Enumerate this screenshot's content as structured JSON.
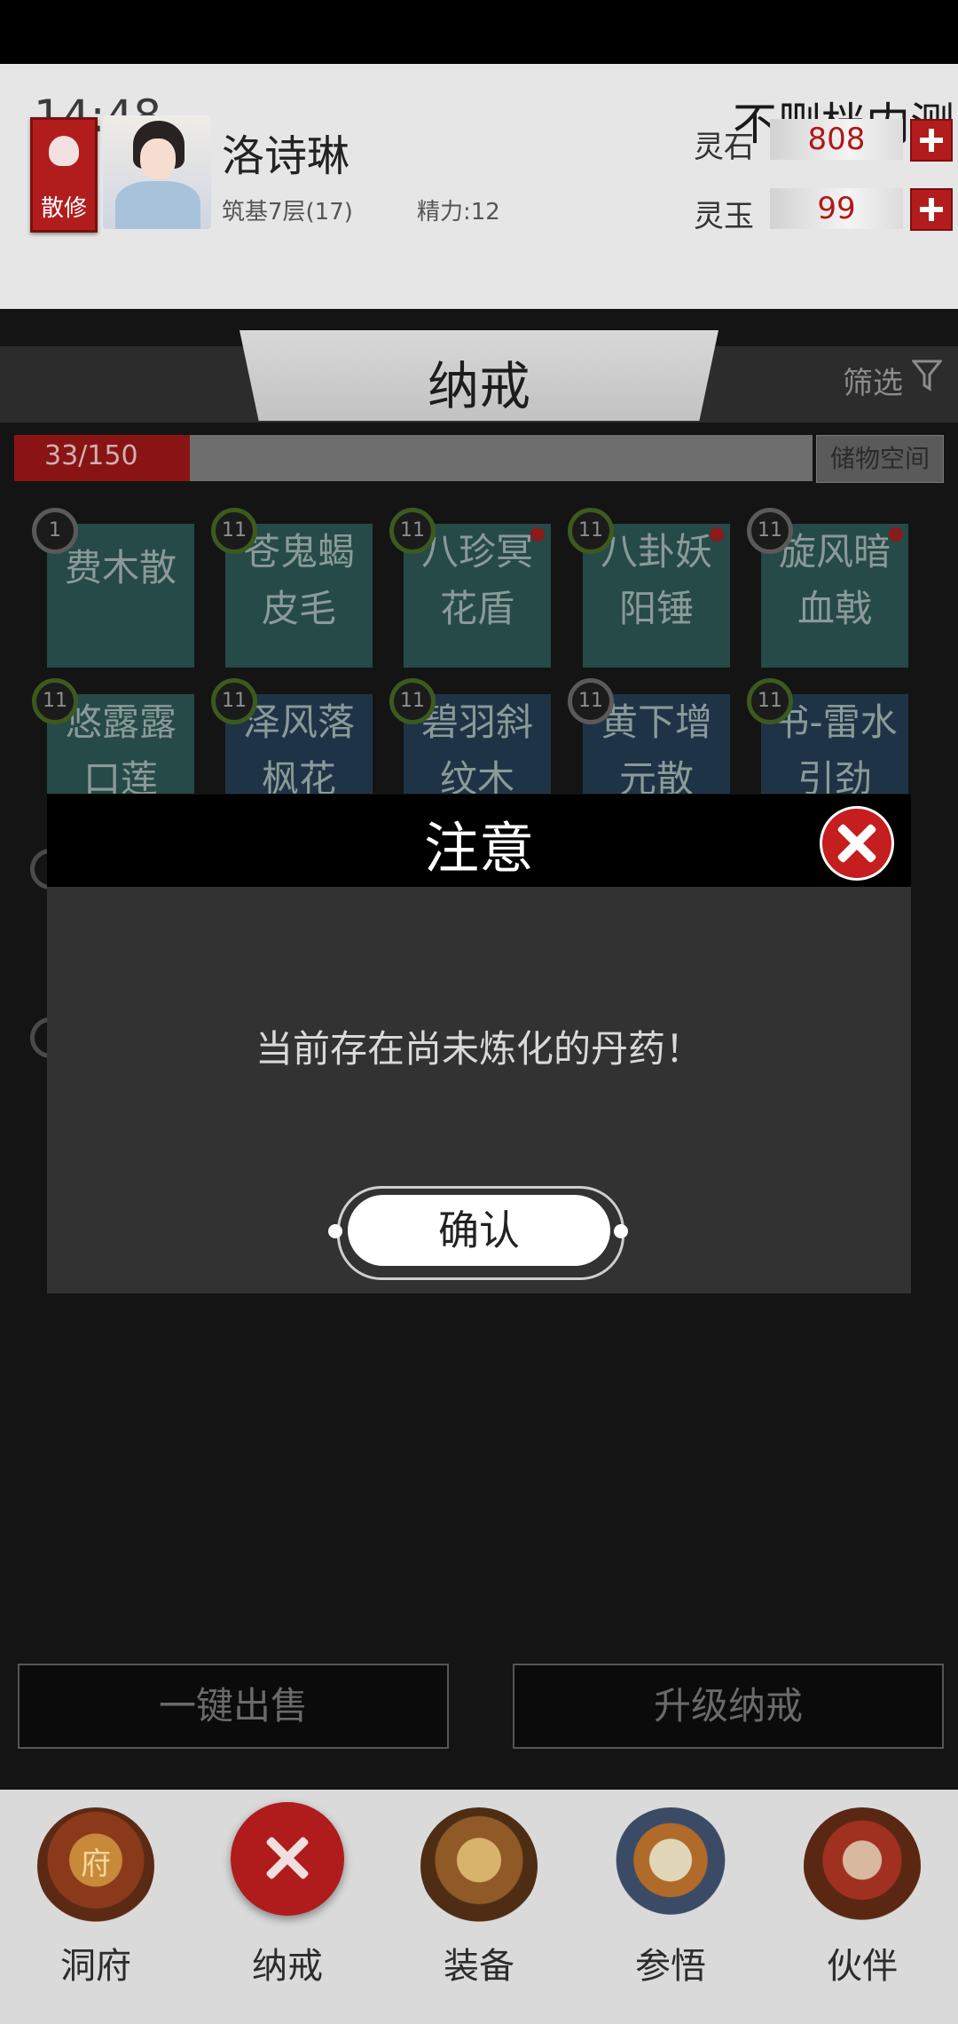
{
  "status": {
    "time": "14:48",
    "server": "不删档内测"
  },
  "player": {
    "sect": "散修",
    "name": "洛诗琳",
    "realm": "筑基7层(17)",
    "stamina": "精力:12"
  },
  "currency": {
    "spirit_stone_label": "灵石",
    "spirit_stone_value": "808",
    "spirit_jade_label": "灵玉",
    "spirit_jade_value": "99"
  },
  "page": {
    "title": "纳戒",
    "filter": "筛选"
  },
  "capacity": {
    "text": "33/150",
    "used": 33,
    "total": 150,
    "storage_button": "储物空间"
  },
  "items_row1": [
    {
      "name_l1": "费木散",
      "name_l2": "",
      "level": "1",
      "ring": "gray",
      "dot": false
    },
    {
      "name_l1": "苍鬼蝎",
      "name_l2": "皮毛",
      "level": "11",
      "ring": "green",
      "dot": false
    },
    {
      "name_l1": "八珍冥",
      "name_l2": "花盾",
      "level": "11",
      "ring": "green",
      "dot": true
    },
    {
      "name_l1": "八卦妖",
      "name_l2": "阳锤",
      "level": "11",
      "ring": "green",
      "dot": true
    },
    {
      "name_l1": "旋风暗",
      "name_l2": "血戟",
      "level": "11",
      "ring": "gray",
      "dot": true
    }
  ],
  "items_row2": [
    {
      "name_l1": "悠露露",
      "name_l2": "口莲",
      "level": "11",
      "ring": "green"
    },
    {
      "name_l1": "泽风落",
      "name_l2": "枫花",
      "level": "11",
      "ring": "green"
    },
    {
      "name_l1": "碧羽斜",
      "name_l2": "纹木",
      "level": "11",
      "ring": "green"
    },
    {
      "name_l1": "黄下增",
      "name_l2": "元散",
      "level": "11",
      "ring": "gray"
    },
    {
      "name_l1": "书-雷水",
      "name_l2": "引劲",
      "level": "11",
      "ring": "green"
    }
  ],
  "dialog": {
    "title": "注意",
    "message": "当前存在尚未炼化的丹药！",
    "confirm": "确认"
  },
  "actions": {
    "sell_all": "一键出售",
    "upgrade": "升级纳戒"
  },
  "nav": [
    {
      "label": "洞府",
      "icon": "mansion-emblem-icon",
      "badge_text": "府"
    },
    {
      "label": "纳戒",
      "icon": "close-icon"
    },
    {
      "label": "装备",
      "icon": "helmet-emblem-icon"
    },
    {
      "label": "参悟",
      "icon": "scroll-emblem-icon"
    },
    {
      "label": "伙伴",
      "icon": "companion-emblem-icon"
    }
  ],
  "colors": {
    "accent_red": "#b21c1c",
    "value_red": "#b01818",
    "header_bg": "#e6e6e6"
  }
}
